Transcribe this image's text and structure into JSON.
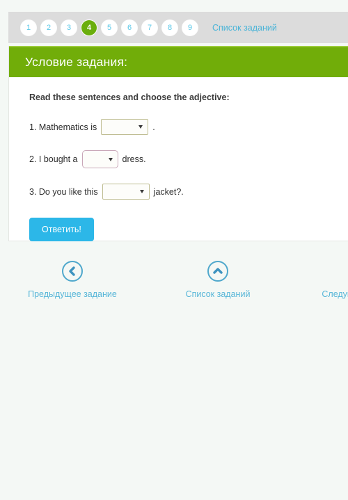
{
  "pager": {
    "pages": [
      "1",
      "2",
      "3",
      "4",
      "5",
      "6",
      "7",
      "8",
      "9"
    ],
    "current": "4",
    "list_link": "Список заданий"
  },
  "card": {
    "header_title": "Условие задания:",
    "prompt": "Read these sentences and choose the adjective:",
    "questions": [
      {
        "before": "1. Mathematics is",
        "after": ".",
        "select_value": "",
        "select_style": "olive"
      },
      {
        "before": "2. I bought a",
        "after": "dress.",
        "select_value": "",
        "select_style": "pink"
      },
      {
        "before": "3. Do you like this",
        "after": "jacket?.",
        "select_value": "",
        "select_style": "olive"
      }
    ],
    "submit_label": "Ответить!"
  },
  "bottom_nav": {
    "prev_label": "Предыдущее задание",
    "list_label": "Список заданий",
    "next_label": "Следующее задание"
  },
  "colors": {
    "header_green": "#71ad09",
    "accent_blue": "#4ab4d8",
    "button_blue": "#2cb7e8",
    "page_background": "#f4f8f5",
    "pager_background": "#dcdcdc"
  }
}
